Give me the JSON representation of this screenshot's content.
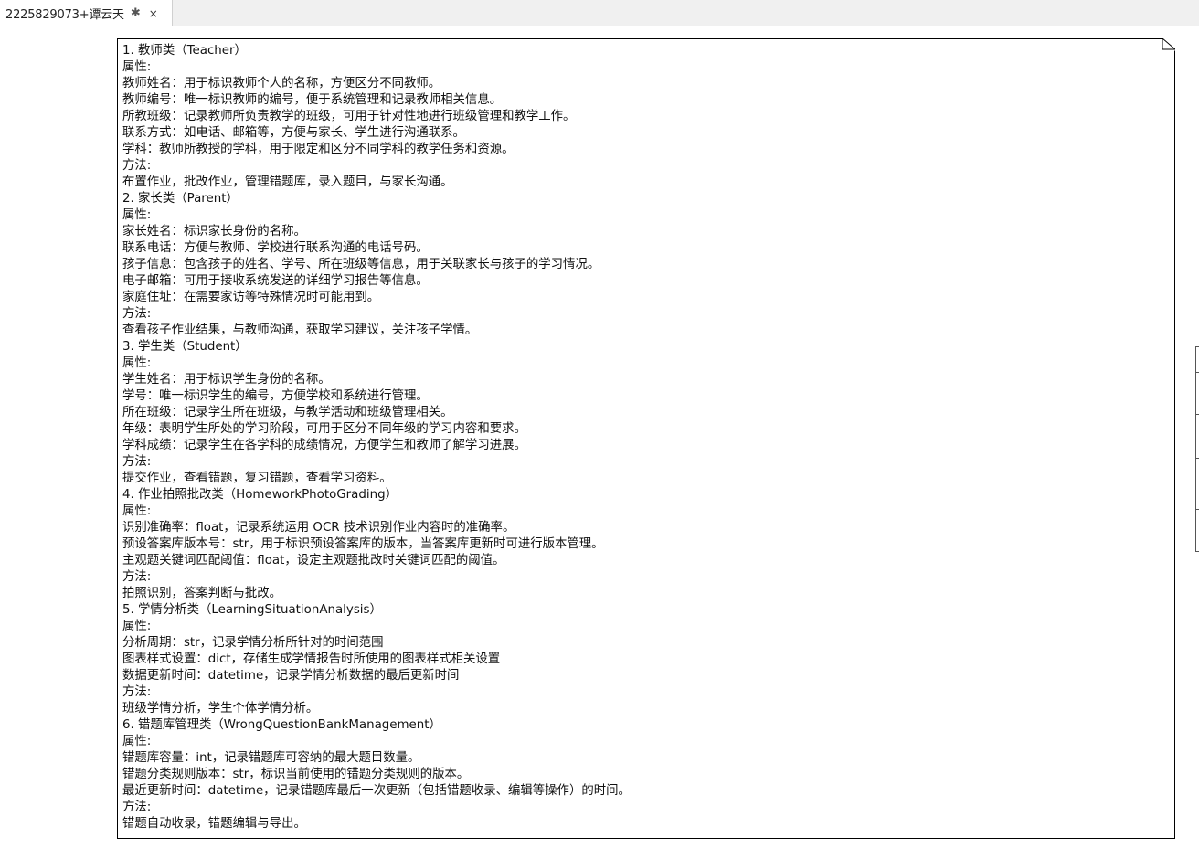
{
  "tab": {
    "title": "2225829073+谭云天",
    "modified_marker": "✱",
    "close_label": "×"
  },
  "note": {
    "lines": [
      "1. 教师类（Teacher）",
      "属性:",
      "教师姓名：用于标识教师个人的名称，方便区分不同教师。",
      "教师编号：唯一标识教师的编号，便于系统管理和记录教师相关信息。",
      "所教班级：记录教师所负责教学的班级，可用于针对性地进行班级管理和教学工作。",
      "联系方式：如电话、邮箱等，方便与家长、学生进行沟通联系。",
      "学科：教师所教授的学科，用于限定和区分不同学科的教学任务和资源。",
      "方法:",
      "布置作业，批改作业，管理错题库，录入题目，与家长沟通。",
      "2. 家长类（Parent）",
      "属性:",
      "家长姓名：标识家长身份的名称。",
      "联系电话：方便与教师、学校进行联系沟通的电话号码。",
      "孩子信息：包含孩子的姓名、学号、所在班级等信息，用于关联家长与孩子的学习情况。",
      "电子邮箱：可用于接收系统发送的详细学习报告等信息。",
      "家庭住址：在需要家访等特殊情况时可能用到。",
      "方法:",
      "查看孩子作业结果，与教师沟通，获取学习建议，关注孩子学情。",
      "3. 学生类（Student）",
      "属性:",
      "学生姓名：用于标识学生身份的名称。",
      "学号：唯一标识学生的编号，方便学校和系统进行管理。",
      "所在班级：记录学生所在班级，与教学活动和班级管理相关。",
      "年级：表明学生所处的学习阶段，可用于区分不同年级的学习内容和要求。",
      "学科成绩：记录学生在各学科的成绩情况，方便学生和教师了解学习进展。",
      "方法:",
      "提交作业，查看错题，复习错题，查看学习资料。",
      "4. 作业拍照批改类（HomeworkPhotoGrading）",
      "属性:",
      "识别准确率：float，记录系统运用 OCR 技术识别作业内容时的准确率。",
      "预设答案库版本号：str，用于标识预设答案库的版本，当答案库更新时可进行版本管理。",
      "主观题关键词匹配阈值：float，设定主观题批改时关键词匹配的阈值。",
      "方法:",
      "拍照识别，答案判断与批改。",
      "5. 学情分析类（LearningSituationAnalysis）",
      "属性:",
      "分析周期：str，记录学情分析所针对的时间范围",
      "图表样式设置：dict，存储生成学情报告时所使用的图表样式相关设置",
      "数据更新时间：datetime，记录学情分析数据的最后更新时间",
      "方法:",
      "班级学情分析，学生个体学情分析。",
      "6. 错题库管理类（WrongQuestionBankManagement）",
      "属性:",
      "错题库容量：int，记录错题库可容纳的最大题目数量。",
      "错题分类规则版本：str，标识当前使用的错题分类规则的版本。",
      "最近更新时间：datetime，记录错题库最后一次更新（包括错题收录、编辑等操作）的时间。",
      "方法:",
      "错题自动收录，错题编辑与导出。"
    ]
  }
}
